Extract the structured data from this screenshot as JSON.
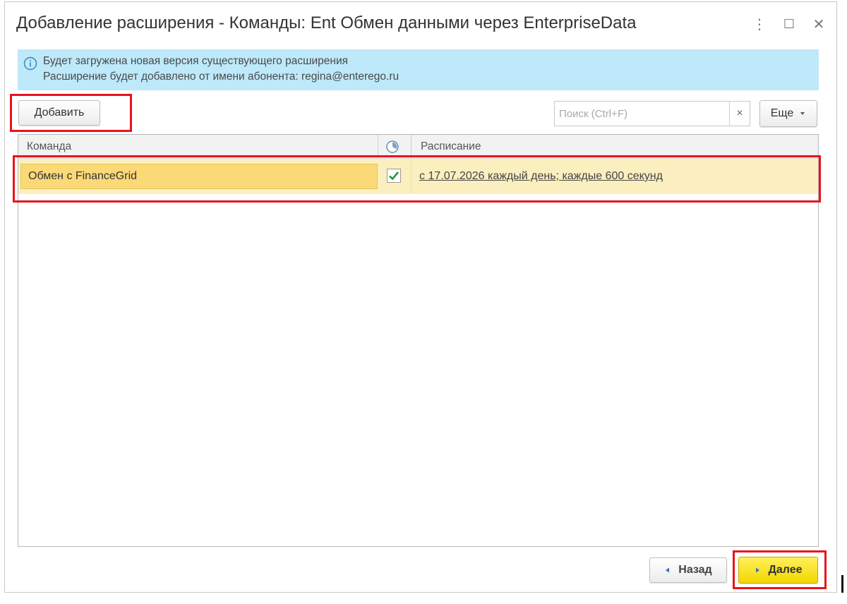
{
  "window": {
    "title": "Добавление расширения - Команды: Ent Обмен данными через EnterpriseData",
    "controls": {
      "more": "⋮",
      "maximize": "☐",
      "close": "✕"
    }
  },
  "info": {
    "line1": "Будет загружена новая версия существующего расширения",
    "line2": "Расширение будет добавлено от имени абонента: regina@enterego.ru"
  },
  "toolbar": {
    "add_label": "Добавить",
    "search_placeholder": "Поиск (Ctrl+F)",
    "search_clear": "×",
    "more_label": "Еще"
  },
  "table": {
    "columns": {
      "command": "Команда",
      "schedule": "Расписание"
    },
    "rows": [
      {
        "command": "Обмен с FinanceGrid",
        "enabled": true,
        "schedule": "с 17.07.2026 каждый день; каждые 600 секунд"
      }
    ]
  },
  "footer": {
    "back_label": "Назад",
    "next_label": "Далее"
  },
  "colors": {
    "info_bg": "#bde9fa",
    "highlight_frame": "#e8141c",
    "row_bg": "#fbefc0",
    "selected_cell": "#fbd977",
    "check_green": "#1f9d3a",
    "next_button": "#f4d600"
  },
  "icons": {
    "info": "info-circle-icon",
    "check": "checkmark-icon",
    "column_header": "clock-icon",
    "dropdown": "triangle-down-icon",
    "back": "triangle-left-icon",
    "next": "triangle-right-icon"
  }
}
